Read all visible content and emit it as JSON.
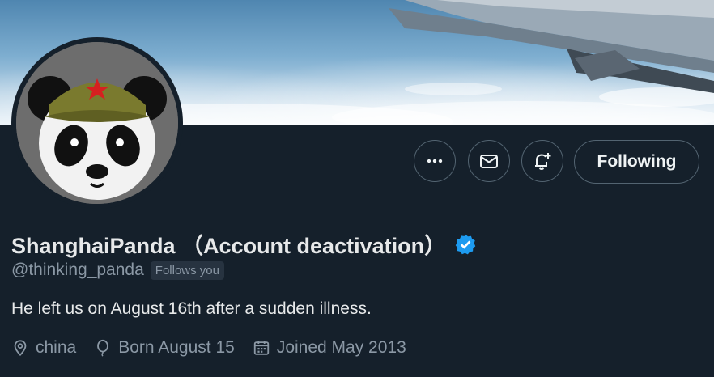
{
  "profile": {
    "display_name": "ShanghaiPanda （Account deactivation）",
    "handle": "@thinking_panda",
    "follows_you_badge": "Follows you",
    "bio": "He left us on August 16th after a sudden illness.",
    "verified": true
  },
  "meta": {
    "location": "china",
    "birthday": "Born August 15",
    "joined": "Joined May 2013"
  },
  "actions": {
    "follow_label": "Following"
  },
  "icons": {
    "more": "more-icon",
    "message": "envelope-icon",
    "notify": "bell-plus-icon",
    "verified": "verified-badge-icon",
    "location": "location-pin-icon",
    "birthday": "balloon-icon",
    "joined": "calendar-icon"
  },
  "colors": {
    "background": "#15202b",
    "verified": "#1d9bf0",
    "muted_text": "#8b98a5",
    "border": "#536471"
  }
}
